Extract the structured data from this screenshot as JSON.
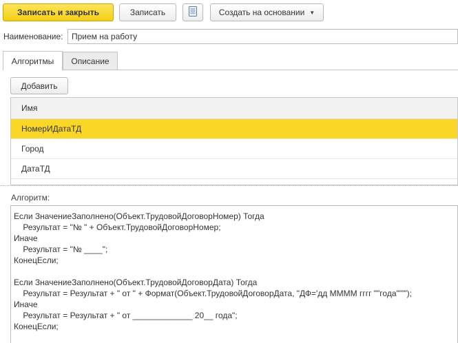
{
  "toolbar": {
    "save_close_label": "Записать и закрыть",
    "save_label": "Записать",
    "create_basis_label": "Создать на основании",
    "create_basis_chevron": "▼"
  },
  "name_field": {
    "label": "Наименование:",
    "value": "Прием на работу"
  },
  "tabs": [
    {
      "label": "Алгоритмы",
      "active": true
    },
    {
      "label": "Описание",
      "active": false
    }
  ],
  "add_button_label": "Добавить",
  "table": {
    "column_header": "Имя",
    "rows": [
      {
        "name": "НомерИДатаТД",
        "selected": true
      },
      {
        "name": "Город",
        "selected": false
      },
      {
        "name": "ДатаТД",
        "selected": false
      }
    ]
  },
  "algorithm": {
    "label": "Алгоритм:",
    "lines": [
      "Если ЗначениеЗаполнено(Объект.ТрудовойДоговорНомер) Тогда",
      "    Результат = \"№ \" + Объект.ТрудовойДоговорНомер;",
      "Иначе",
      "    Результат = \"№ ____\";",
      "КонецЕсли;",
      "",
      "Если ЗначениеЗаполнено(Объект.ТрудовойДоговорДата) Тогда",
      "    Результат = Результат + \" от \" + Формат(Объект.ТрудовойДоговорДата, \"ДФ='дд ММММ гггг \"\"года\"\"'\");",
      "Иначе",
      "    Результат = Результат + \" от _____________ 20__ года\";",
      "КонецЕсли;"
    ]
  },
  "colors": {
    "primary_button": "#f5cf16",
    "selected_row": "#fad627"
  },
  "icons": {
    "report_icon": "document-list-icon"
  }
}
